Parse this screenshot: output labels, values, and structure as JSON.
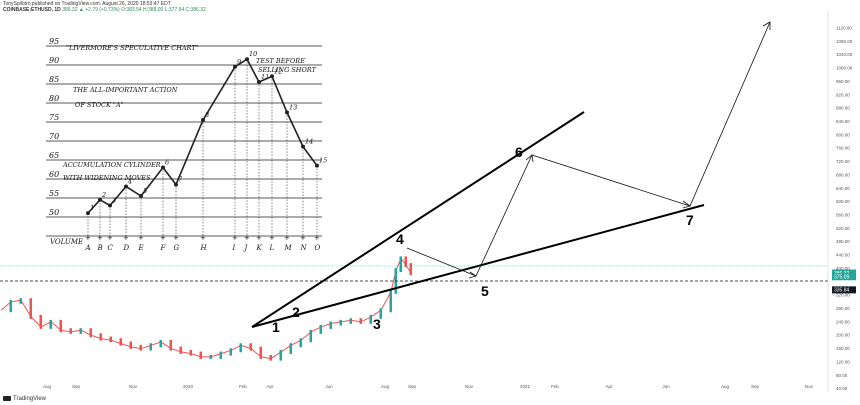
{
  "header": {
    "publisher_line": "TonySpilotro published on TradingView.com, August 26, 2020 18:53:47 EDT",
    "symbol": "COINBASE:ETHUSD, 1D",
    "ohlc_text": "386.32 ▲ +2.79 (+0.73%) O:383.54 H:388.00 L:377.54 C:386.32"
  },
  "brand": {
    "label": "TradingView"
  },
  "colors": {
    "up": "#26a69a",
    "down": "#ef5350",
    "trendline": "#000000",
    "current_price": "#26a69a",
    "support_label": "#131722"
  },
  "chart_data": [
    {
      "type": "line",
      "title": "ETHUSD daily with Elliott-style wave projection",
      "x_axis_labels": [
        "Aug",
        "Sep",
        "Nov",
        "2020",
        "Feb",
        "Apr",
        "Jun",
        "Aug",
        "Sep",
        "Nov",
        "2021",
        "Feb",
        "Apr",
        "Jun",
        "Aug",
        "Sep",
        "Nov"
      ],
      "y_axis_labels": [
        "1120.00",
        "1040.00",
        "960.00",
        "880.00",
        "800.00",
        "720.00",
        "640.00",
        "560.00",
        "480.00",
        "400.00",
        "320.00",
        "240.00",
        "160.00",
        "80.00",
        "1080.00",
        "1000.00",
        "920.00",
        "840.00",
        "760.00",
        "680.00",
        "600.00",
        "520.00",
        "440.00",
        "280.00",
        "200.00",
        "120.00",
        "40.00"
      ],
      "ylim": [
        30,
        1150
      ],
      "price_labels": [
        {
          "text": "386.32",
          "value": 386.32,
          "kind": "last"
        },
        {
          "text": "375.09",
          "value": 375.09,
          "kind": "sub"
        },
        {
          "text": "335.84",
          "value": 335.84,
          "kind": "support"
        }
      ],
      "wave_labels": [
        "1",
        "2",
        "3",
        "4",
        "5",
        "6",
        "7"
      ],
      "series": [
        {
          "name": "price",
          "x": [
            0,
            10,
            20,
            30,
            40,
            50,
            60,
            70,
            80,
            90,
            100,
            110,
            120,
            130,
            140,
            150,
            160,
            170,
            180,
            190,
            200,
            210,
            220,
            230,
            240,
            250,
            260,
            270,
            280,
            290,
            300,
            310,
            320,
            330,
            340,
            350,
            360,
            370,
            380,
            390,
            395,
            400,
            405,
            410
          ],
          "values": [
            275,
            300,
            305,
            255,
            225,
            240,
            215,
            210,
            215,
            200,
            190,
            185,
            175,
            165,
            160,
            170,
            180,
            160,
            150,
            145,
            135,
            135,
            145,
            155,
            170,
            160,
            135,
            130,
            150,
            170,
            185,
            210,
            225,
            235,
            240,
            245,
            240,
            255,
            275,
            330,
            395,
            430,
            410,
            386
          ]
        }
      ],
      "wave_path_values": [
        {
          "label": "1",
          "value": 210
        },
        {
          "label": "2",
          "value": 250
        },
        {
          "label": "3",
          "value": 228
        },
        {
          "label": "4",
          "value": 440
        },
        {
          "label": "5",
          "value": 345
        },
        {
          "label": "6",
          "value": 700
        },
        {
          "label": "7",
          "value": 560
        }
      ]
    },
    {
      "type": "line",
      "title": "Livermore's Speculative Chart",
      "annotations": [
        "\"LIVERMORE'S SPECULATIVE CHART\"",
        "THE ALL-IMPORTANT ACTION",
        "OF STOCK \"A\"",
        "ACCUMULATION CYLINDER",
        "WITH WIDENING MOVES",
        "TEST BEFORE",
        "SELLING SHORT"
      ],
      "y_tick_labels": [
        "95",
        "90",
        "85",
        "80",
        "75",
        "70",
        "65",
        "60",
        "55",
        "50"
      ],
      "ylabel": "VOLUME",
      "categories": [
        "A",
        "B",
        "C",
        "D",
        "E",
        "F",
        "G",
        "H",
        "I",
        "J",
        "K",
        "L",
        "M",
        "N",
        "O"
      ],
      "point_labels": [
        "1",
        "2",
        "3",
        "4",
        "5",
        "6",
        "7",
        "8",
        "9",
        "10",
        "11",
        "12",
        "13",
        "14",
        "15"
      ],
      "values": [
        50.5,
        54,
        52.5,
        57.5,
        55,
        62.5,
        58,
        75,
        89,
        91,
        85,
        86.5,
        77,
        68,
        63
      ]
    }
  ]
}
